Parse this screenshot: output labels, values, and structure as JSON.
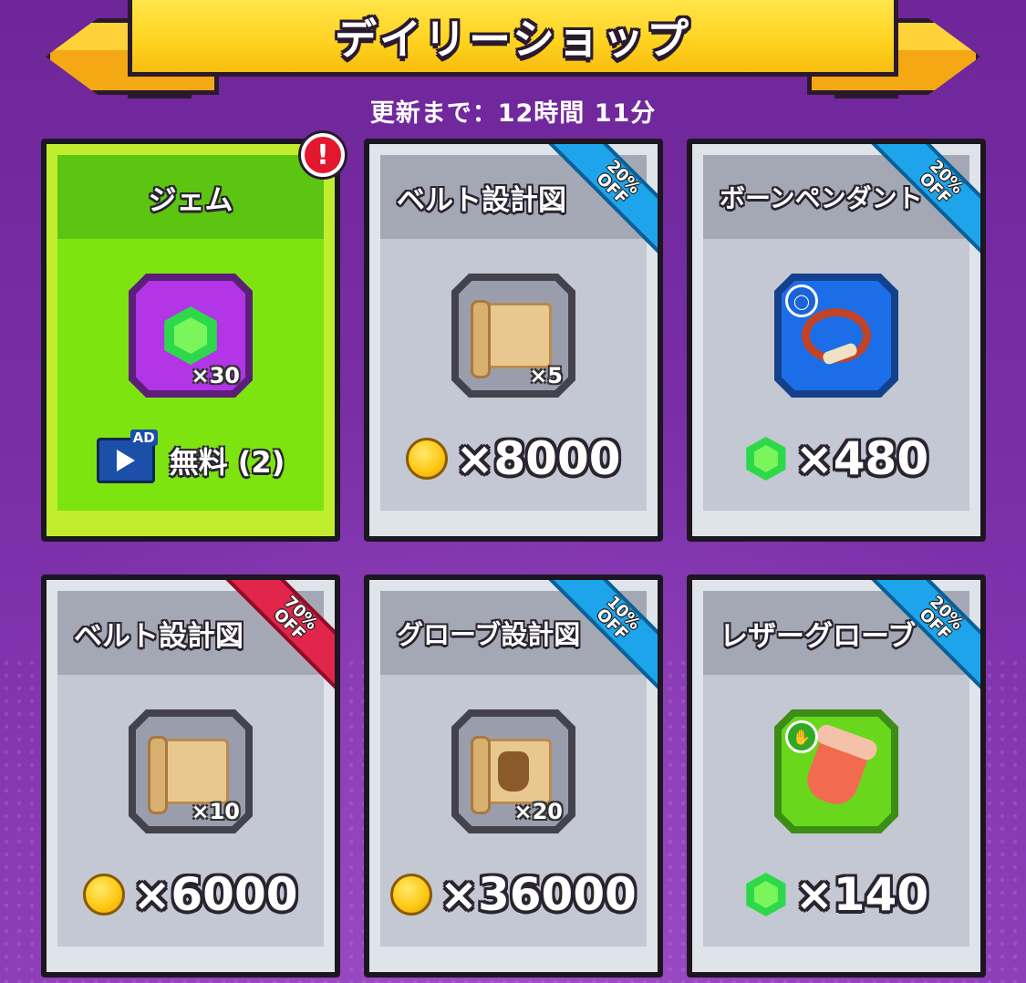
{
  "header": {
    "title": "デイリーショップ",
    "refresh_text": "更新まで：12時間 11分"
  },
  "colors": {
    "background": "#7a2fa6",
    "banner": "#ffd21f",
    "free_card": "#7ee410",
    "discount_blue": "#1ea4ea",
    "discount_red": "#e2254a"
  },
  "cards": [
    {
      "name": "ジェム",
      "quantity": "×30",
      "item_icon": "gem-icon",
      "alert": "!",
      "action_icon": "ad-video-icon",
      "ad_tag": "AD",
      "action_text": "無料 (2)"
    },
    {
      "name": "ベルト設計図",
      "quantity": "×5",
      "item_icon": "belt-blueprint-icon",
      "discount_percent": "20%",
      "discount_off": "OFF",
      "currency_icon": "coin-icon",
      "price": "×8000"
    },
    {
      "name": "ボーンペンダント",
      "quantity": "",
      "item_icon": "bone-pendant-icon",
      "slot_icon": "necklace-slot-icon",
      "discount_percent": "20%",
      "discount_off": "OFF",
      "currency_icon": "gem-icon",
      "price": "×480"
    },
    {
      "name": "ベルト設計図",
      "quantity": "×10",
      "item_icon": "belt-blueprint-icon",
      "discount_percent": "70%",
      "discount_off": "OFF",
      "currency_icon": "coin-icon",
      "price": "×6000"
    },
    {
      "name": "グローブ設計図",
      "quantity": "×20",
      "item_icon": "glove-blueprint-icon",
      "discount_percent": "10%",
      "discount_off": "OFF",
      "currency_icon": "coin-icon",
      "price": "×36000"
    },
    {
      "name": "レザーグローブ",
      "quantity": "",
      "item_icon": "leather-glove-icon",
      "slot_icon": "glove-slot-icon",
      "discount_percent": "20%",
      "discount_off": "OFF",
      "currency_icon": "gem-icon",
      "price": "×140"
    }
  ]
}
